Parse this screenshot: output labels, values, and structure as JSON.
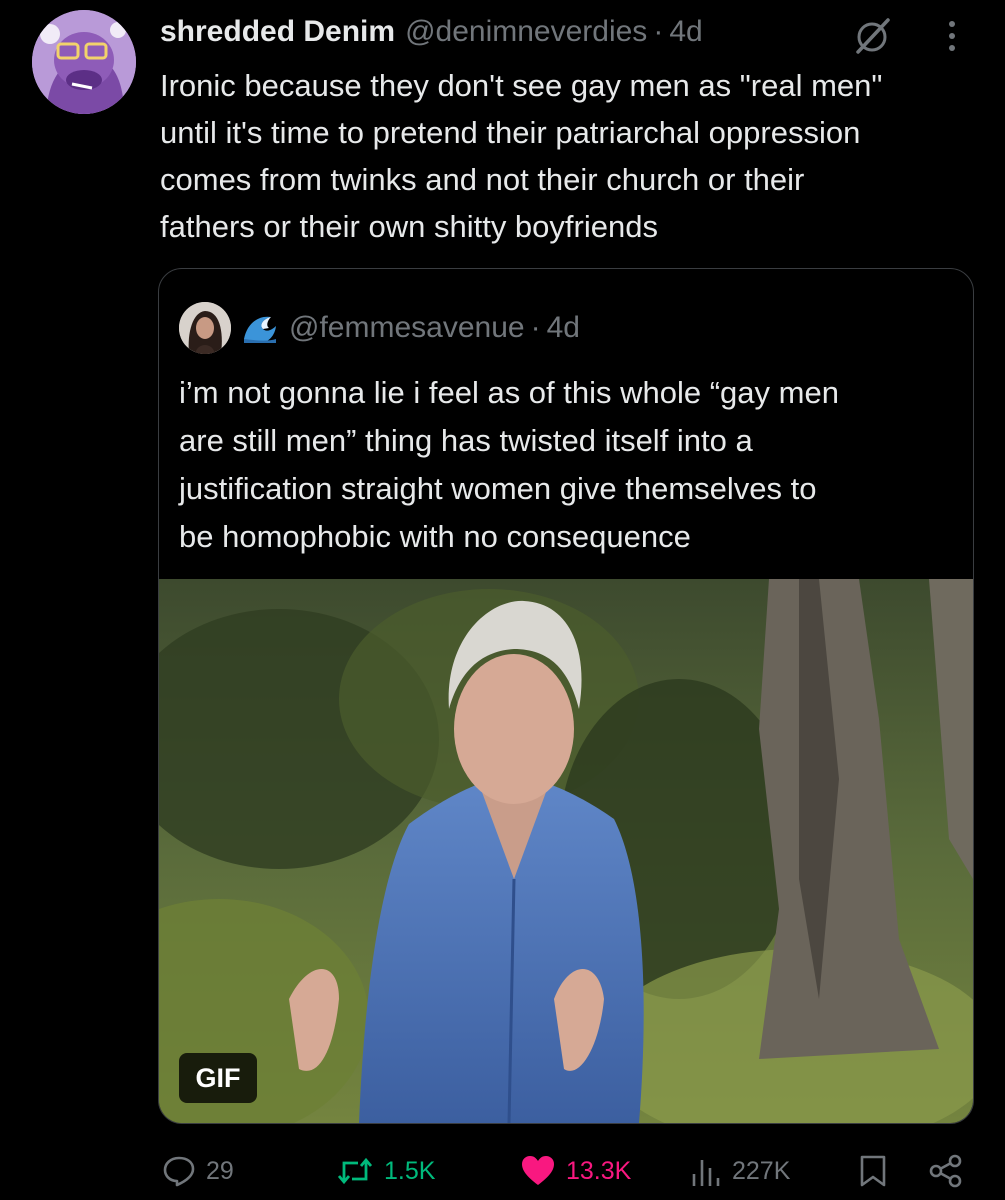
{
  "post": {
    "display_name": "shredded Denim",
    "handle": "@denimneverdies",
    "separator": "·",
    "age": "4d",
    "text_lines": [
      "Ironic because they don't see gay men as \"real men\"",
      "until it's time to pretend their patriarchal oppression",
      "comes from twinks and not their church or their",
      "fathers or their own shitty boyfriends"
    ]
  },
  "quote": {
    "handle": "@femmesavenue",
    "separator": "·",
    "age": "4d",
    "text_lines": [
      "i’m not gonna lie i feel as of this whole “gay men",
      "are still men” thing has twisted itself into a",
      "justification straight women give themselves to",
      "be homophobic with no consequence"
    ],
    "media_badge": "GIF"
  },
  "actions": {
    "replies": "29",
    "reposts": "1.5K",
    "likes": "13.3K",
    "views": "227K"
  },
  "colors": {
    "background": "#000000",
    "text": "#e7e9ea",
    "muted": "#71767b",
    "repost_active": "#00ba7c",
    "like_active": "#f91880",
    "border": "#3a3d41"
  },
  "icons": [
    "grok-icon",
    "more-icon",
    "wave-emoji-icon",
    "reply-icon",
    "repost-icon",
    "heart-icon",
    "views-icon",
    "bookmark-icon",
    "share-icon"
  ]
}
